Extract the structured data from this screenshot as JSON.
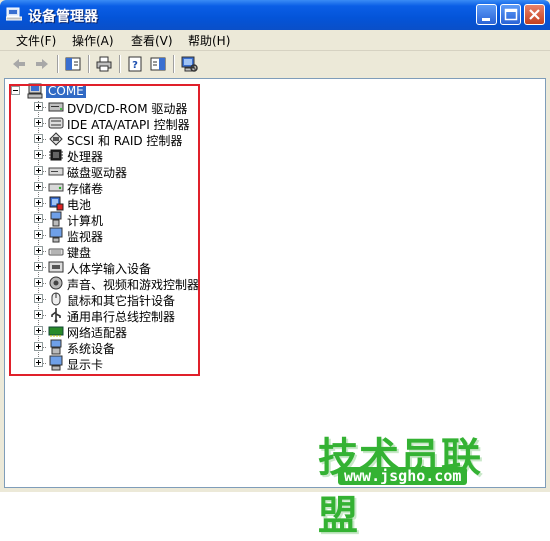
{
  "window": {
    "title": "设备管理器"
  },
  "menu": [
    {
      "label": "文件(F)"
    },
    {
      "label": "操作(A)"
    },
    {
      "label": "查看(V)"
    },
    {
      "label": "帮助(H)"
    }
  ],
  "tree": {
    "root": "COME",
    "items": [
      {
        "label": "DVD/CD-ROM 驱动器",
        "icon": "cdrom-icon"
      },
      {
        "label": "IDE ATA/ATAPI 控制器",
        "icon": "ide-controller-icon"
      },
      {
        "label": "SCSI 和 RAID 控制器",
        "icon": "scsi-controller-icon"
      },
      {
        "label": "处理器",
        "icon": "processor-icon"
      },
      {
        "label": "磁盘驱动器",
        "icon": "disk-drive-icon"
      },
      {
        "label": "存储卷",
        "icon": "storage-volume-icon"
      },
      {
        "label": "电池",
        "icon": "battery-icon"
      },
      {
        "label": "计算机",
        "icon": "computer-icon"
      },
      {
        "label": "监视器",
        "icon": "monitor-icon"
      },
      {
        "label": "键盘",
        "icon": "keyboard-icon"
      },
      {
        "label": "人体学输入设备",
        "icon": "hid-icon"
      },
      {
        "label": "声音、视频和游戏控制器",
        "icon": "sound-icon"
      },
      {
        "label": "鼠标和其它指针设备",
        "icon": "mouse-icon"
      },
      {
        "label": "通用串行总线控制器",
        "icon": "usb-icon"
      },
      {
        "label": "网络适配器",
        "icon": "network-adapter-icon"
      },
      {
        "label": "系统设备",
        "icon": "system-device-icon"
      },
      {
        "label": "显示卡",
        "icon": "display-adapter-icon"
      }
    ]
  },
  "watermark": {
    "text": "技术员联盟",
    "url": "www.jsgho.com"
  }
}
